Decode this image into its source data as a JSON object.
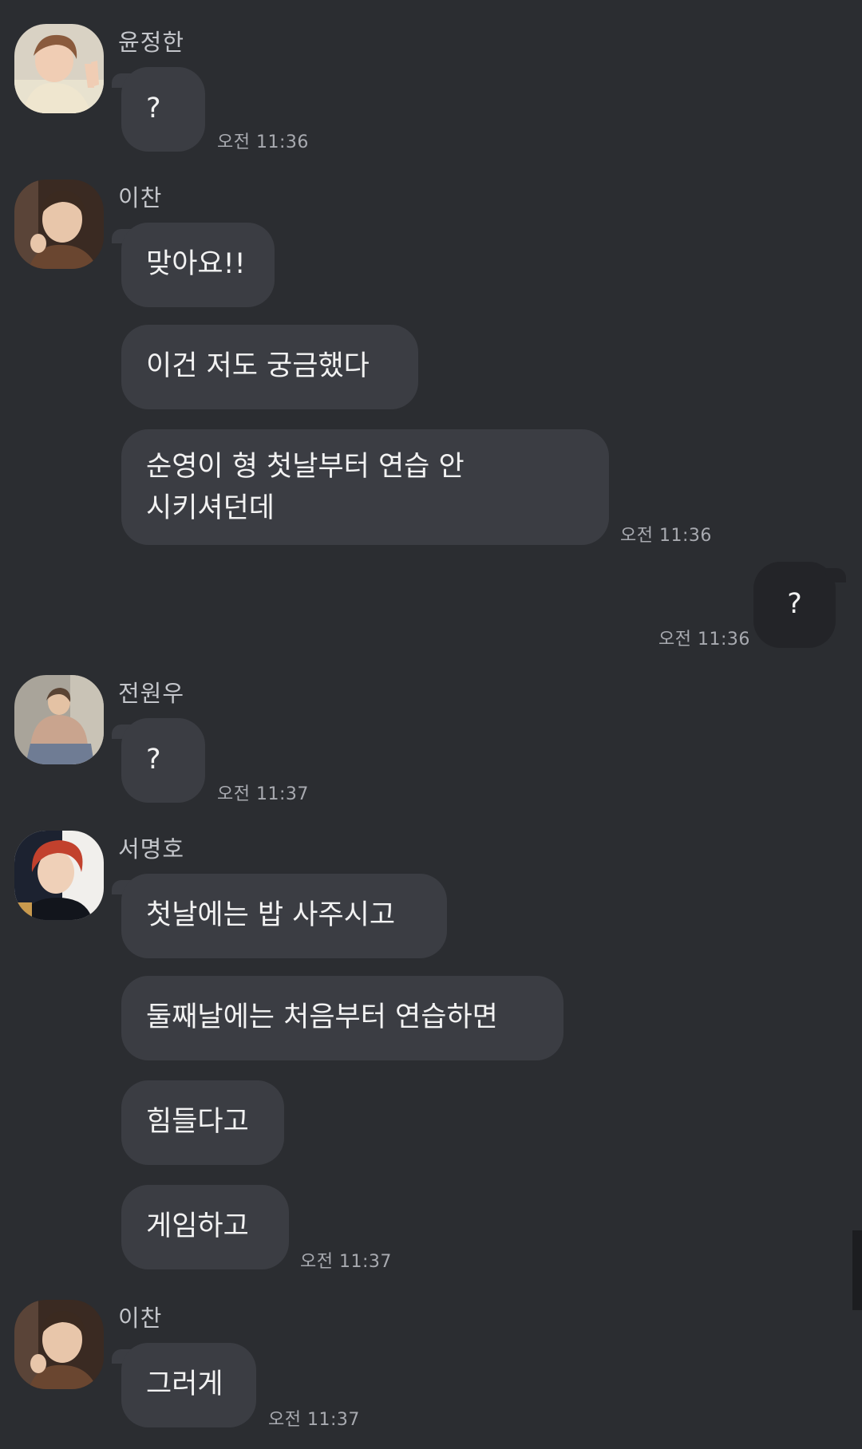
{
  "messages": [
    {
      "sender": "윤정한",
      "avatar": "avatar-jeonghan-icon",
      "bubbles": [
        "?"
      ],
      "time": "오전 11:36"
    },
    {
      "sender": "이찬",
      "avatar": "avatar-chan-icon",
      "bubbles": [
        "맞아요!!",
        "이건 저도 궁금했다",
        "순영이 형 첫날부터 연습 안 시키셔던데"
      ],
      "time": "오전 11:36"
    },
    {
      "sender": "me",
      "bubbles": [
        "?"
      ],
      "time": "오전 11:36"
    },
    {
      "sender": "전원우",
      "avatar": "avatar-wonwoo-icon",
      "bubbles": [
        "?"
      ],
      "time": "오전 11:37"
    },
    {
      "sender": "서명호",
      "avatar": "avatar-minghao-icon",
      "bubbles": [
        "첫날에는 밥 사주시고",
        "둘째날에는 처음부터 연습하면",
        "힘들다고",
        "게임하고"
      ],
      "time": "오전 11:37"
    },
    {
      "sender": "이찬",
      "avatar": "avatar-chan-icon",
      "bubbles": [
        "그러게"
      ],
      "time": "오전 11:37"
    }
  ],
  "colors": {
    "background": "#2b2d31",
    "bubble_other": "#3b3d43",
    "bubble_me": "#232428",
    "timestamp": "#a8aab0",
    "sender_name": "#c4c6cb"
  }
}
